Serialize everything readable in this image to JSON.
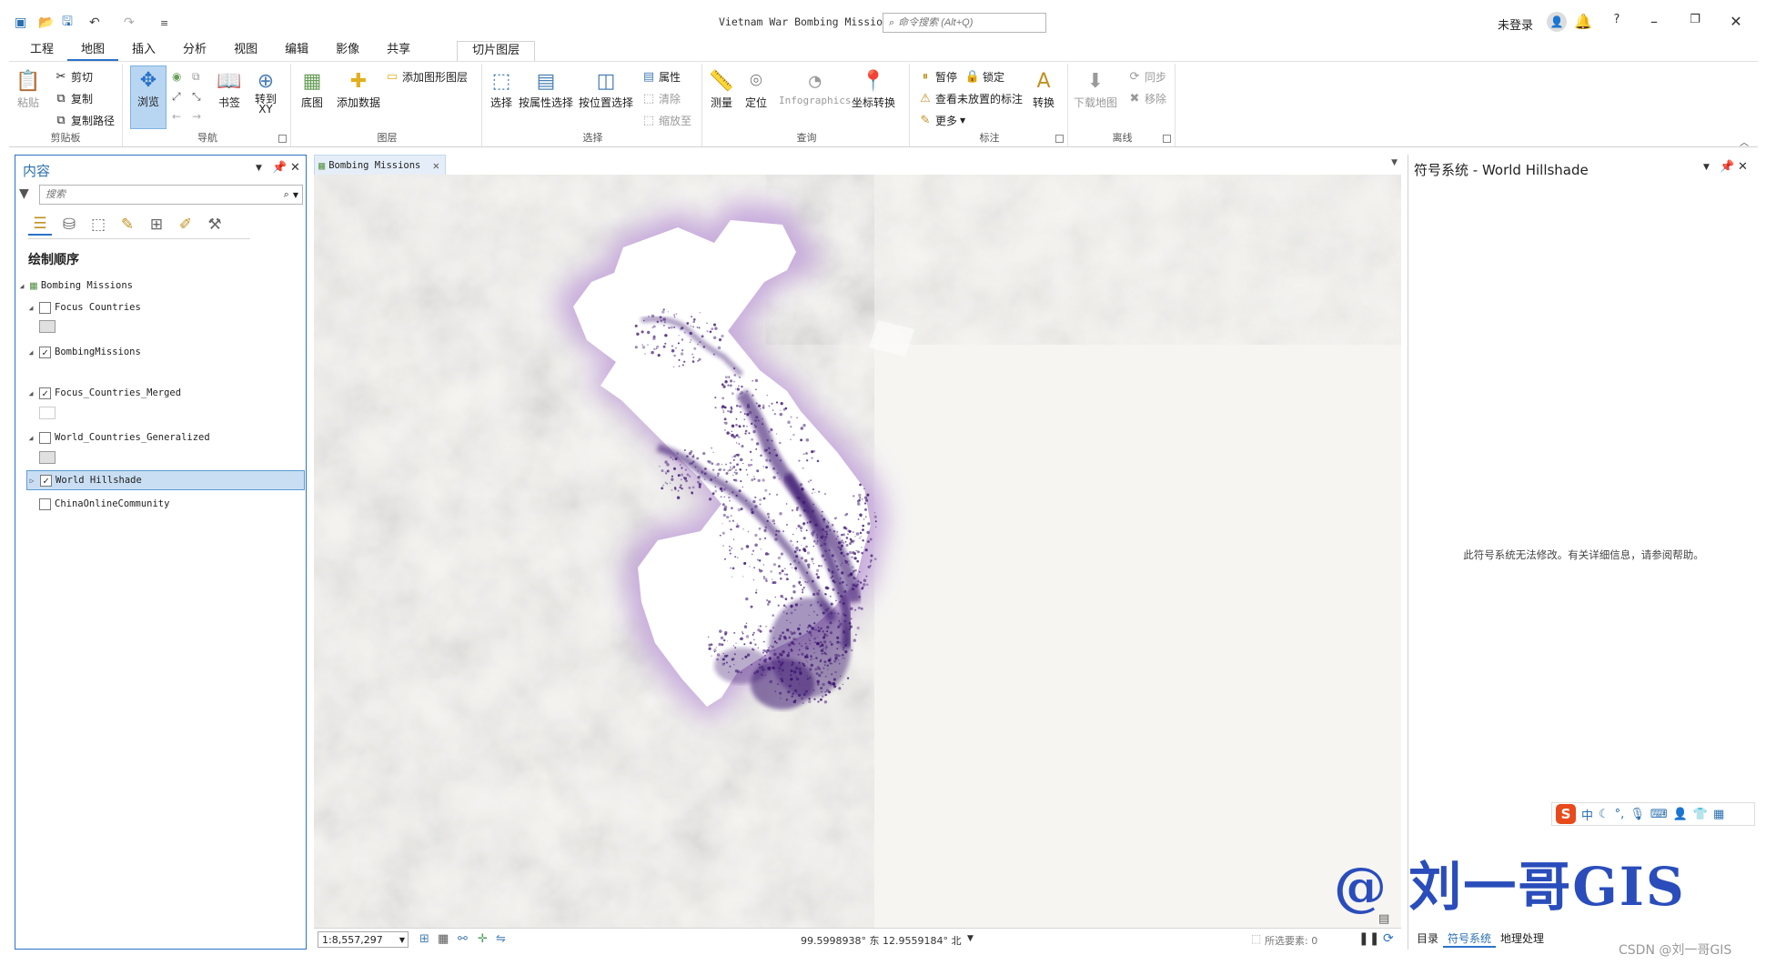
{
  "window": {
    "title": "Vietnam War Bombing Missions",
    "command_search_placeholder": "命令搜索 (Alt+Q)",
    "user_status": "未登录",
    "help_glyph": "?"
  },
  "ribbon": {
    "tabs": [
      "工程",
      "地图",
      "插入",
      "分析",
      "视图",
      "编辑",
      "影像",
      "共享"
    ],
    "active_tab": "地图",
    "context_tab": "切片图层",
    "groups": {
      "clipboard": {
        "label": "剪贴板",
        "paste": "粘贴",
        "cut": "剪切",
        "copy": "复制",
        "copy_path": "复制路径"
      },
      "navigate": {
        "label": "导航",
        "explore": "浏览",
        "bookmarks": "书签",
        "goto_xy": "转到\nXY"
      },
      "layer": {
        "label": "图层",
        "basemap": "底图",
        "add_data": "添加数据",
        "add_graphics": "添加图形图层"
      },
      "selection": {
        "label": "选择",
        "select": "选择",
        "select_by_attr": "按属性选择",
        "select_by_loc": "按位置选择",
        "attributes": "属性",
        "clear": "清除",
        "zoom_to": "缩放至"
      },
      "inquiry": {
        "label": "查询",
        "measure": "测量",
        "locate": "定位",
        "infographics": "Infographics",
        "coord_conv": "坐标转换"
      },
      "labeling": {
        "label": "标注",
        "pause": "暂停",
        "lock": "锁定",
        "view_unplaced": "查看未放置的标注",
        "more": "更多",
        "convert": "转换"
      },
      "offline": {
        "label": "离线",
        "download_map": "下载地图",
        "sync": "同步",
        "remove": "移除"
      }
    }
  },
  "contents": {
    "title": "内容",
    "search_placeholder": "搜索",
    "draw_order_label": "绘制顺序",
    "map_name": "Bombing Missions",
    "layers": [
      {
        "name": "Focus Countries",
        "checked": false,
        "swatch": "#e0e0e0"
      },
      {
        "name": "BombingMissions",
        "checked": true,
        "swatch": null
      },
      {
        "name": "Focus_Countries_Merged",
        "checked": true,
        "swatch": "#ffffff"
      },
      {
        "name": "World_Countries_Generalized",
        "checked": false,
        "swatch": "#e0e0e0"
      },
      {
        "name": "World Hillshade",
        "checked": true,
        "swatch": null,
        "selected": true
      },
      {
        "name": "ChinaOnlineCommunity",
        "checked": false,
        "swatch": null
      }
    ]
  },
  "map_view": {
    "tab_label": "Bombing Missions",
    "scale": "1:8,557,297",
    "coordinates": "99.5998938° 东 12.9559184° 北",
    "selected_features": "所选要素: 0",
    "colors": {
      "hillshade": "#f6f5f2",
      "focus": "#ffffff",
      "glow": "#c6a8dc",
      "missions": "#3b1470"
    }
  },
  "symbology": {
    "title": "符号系统 - World Hillshade",
    "message": "此符号系统无法修改。有关详细信息，请参阅帮助。",
    "bottom_tabs": [
      "目录",
      "符号系统",
      "地理处理"
    ],
    "active_bottom_tab": "符号系统"
  },
  "ime": {
    "logo": "S",
    "mode": "中"
  },
  "watermark": {
    "text": "@ 刘一哥GIS",
    "credit": "CSDN @刘一哥GIS"
  }
}
